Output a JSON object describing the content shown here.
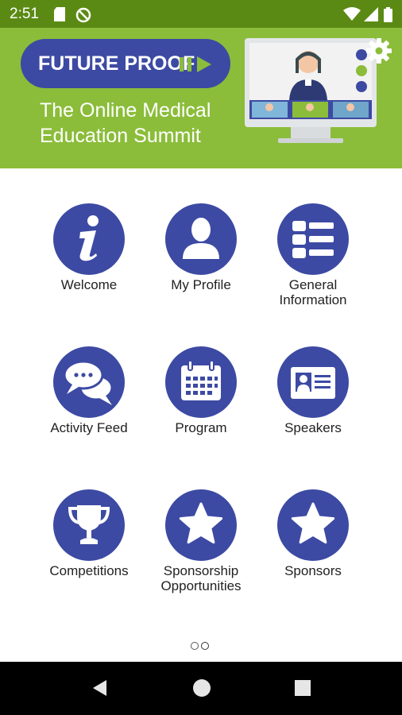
{
  "status_bar": {
    "time": "2:51",
    "icons": [
      "sd-card-icon",
      "no-sync-icon",
      "wifi-icon",
      "signal-icon",
      "battery-icon"
    ]
  },
  "banner": {
    "brand": "FUTURE PROOF",
    "subtitle_line1": "The Online Medical",
    "subtitle_line2": "Education Summit",
    "colors": {
      "banner": "#8bbd3a",
      "pill": "#3d4aa3",
      "accent": "#8bbd3a"
    }
  },
  "menu": {
    "items": [
      {
        "label": "Welcome",
        "icon": "info-icon"
      },
      {
        "label": "My Profile",
        "icon": "person-icon"
      },
      {
        "label_line1": "General",
        "label_line2": "Information",
        "icon": "list-icon"
      },
      {
        "label": "Activity Feed",
        "icon": "chat-icon"
      },
      {
        "label": "Program",
        "icon": "calendar-icon"
      },
      {
        "label": "Speakers",
        "icon": "id-card-icon"
      },
      {
        "label": "Competitions",
        "icon": "trophy-icon"
      },
      {
        "label_line1": "Sponsorship",
        "label_line2": "Opportunities",
        "icon": "star-icon"
      },
      {
        "label": "Sponsors",
        "icon": "star-icon"
      }
    ],
    "circle_color": "#3d4aa3"
  },
  "pager": {
    "pages": 2,
    "current": 2
  },
  "nav_bar": {
    "buttons": [
      "back-icon",
      "home-icon",
      "recents-icon"
    ]
  }
}
